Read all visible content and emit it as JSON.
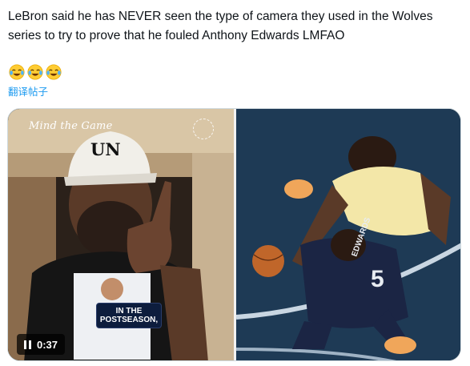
{
  "post": {
    "text": "LeBron said he has NEVER seen the type of camera they used in the Wolves series to try to prove that he fouled Anthony Edwards LMFAO",
    "emojis": [
      "face-with-tears-of-joy-icon",
      "face-with-tears-of-joy-icon",
      "face-with-tears-of-joy-icon"
    ],
    "translate_label": "翻译帖子"
  },
  "media": {
    "watermark": "Mind the Game",
    "hat_text": "UN",
    "shirt_text": "IN THE POSTSEASON,",
    "timer": "0:37",
    "jersey_text": "EDWARDS",
    "jersey_number": "5",
    "colors": {
      "lakers_gold": "#f3e7a8",
      "wolves_navy": "#1b2544",
      "court": "#1e3a55"
    }
  }
}
